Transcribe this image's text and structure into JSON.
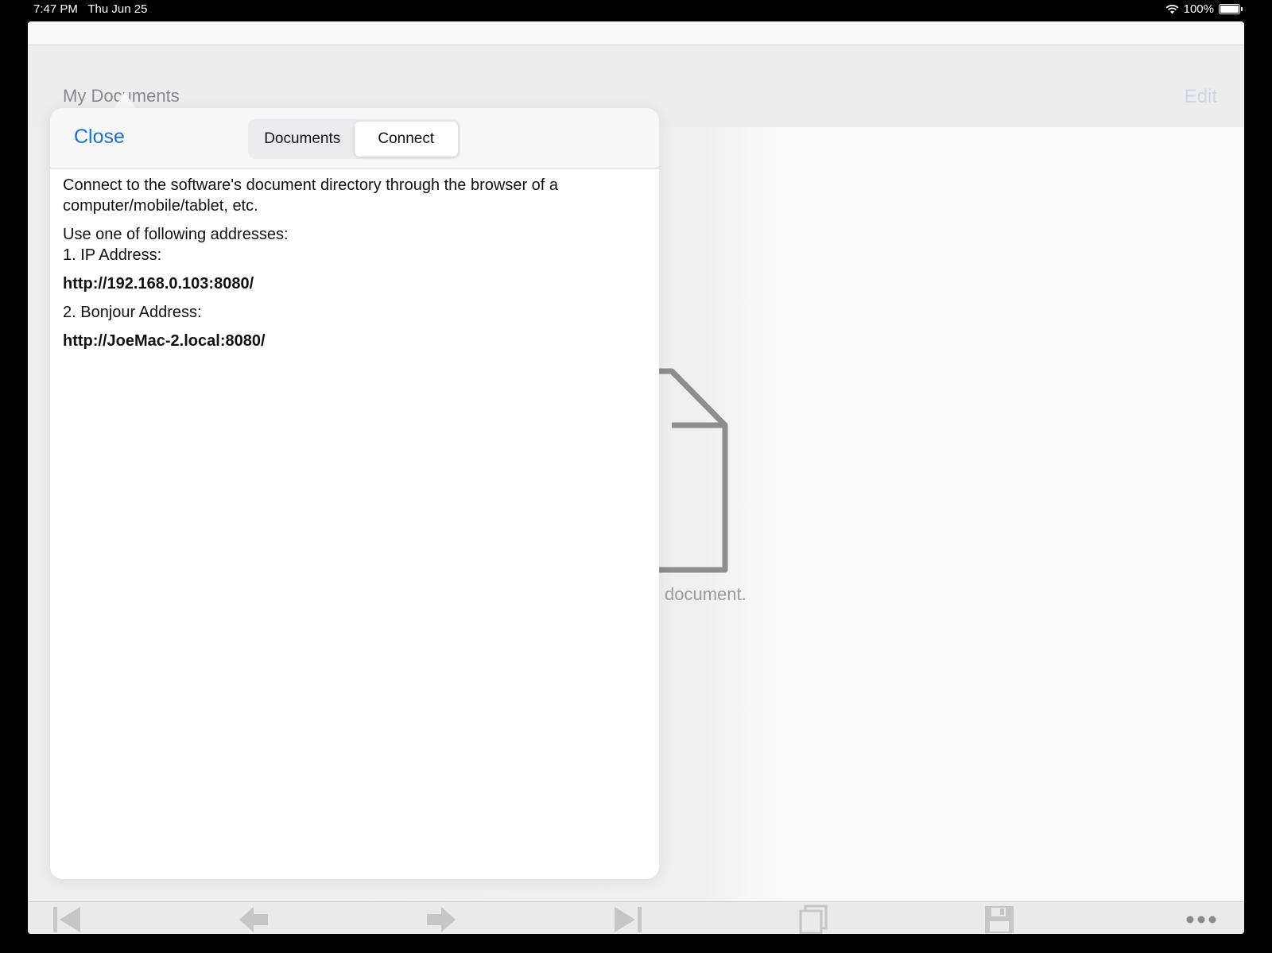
{
  "status_bar": {
    "time": "7:47 PM",
    "date": "Thu Jun 25",
    "battery": "100%",
    "battery_level": 1.0,
    "wifi_icon": "wifi-icon"
  },
  "nav": {
    "title": "My Documents",
    "edit_label": "Edit"
  },
  "background": {
    "empty_text": "document."
  },
  "popover": {
    "close_label": "Close",
    "tabs": [
      {
        "label": "Documents",
        "active": false
      },
      {
        "label": "Connect",
        "active": true
      }
    ],
    "intro": "Connect to the software's document directory through the browser of a computer/mobile/tablet, etc.",
    "use_one": "Use one of following addresses:",
    "ip_label": "1. IP Address:",
    "ip_url": "http://192.168.0.103:8080/",
    "bonjour_label": "2. Bonjour Address:",
    "bonjour_url": "http://JoeMac-2.local:8080/"
  },
  "toolbar": {
    "icons": [
      "first-page-icon",
      "previous-icon",
      "next-icon",
      "last-page-icon",
      "pages-icon",
      "save-icon",
      "more-icon"
    ]
  }
}
